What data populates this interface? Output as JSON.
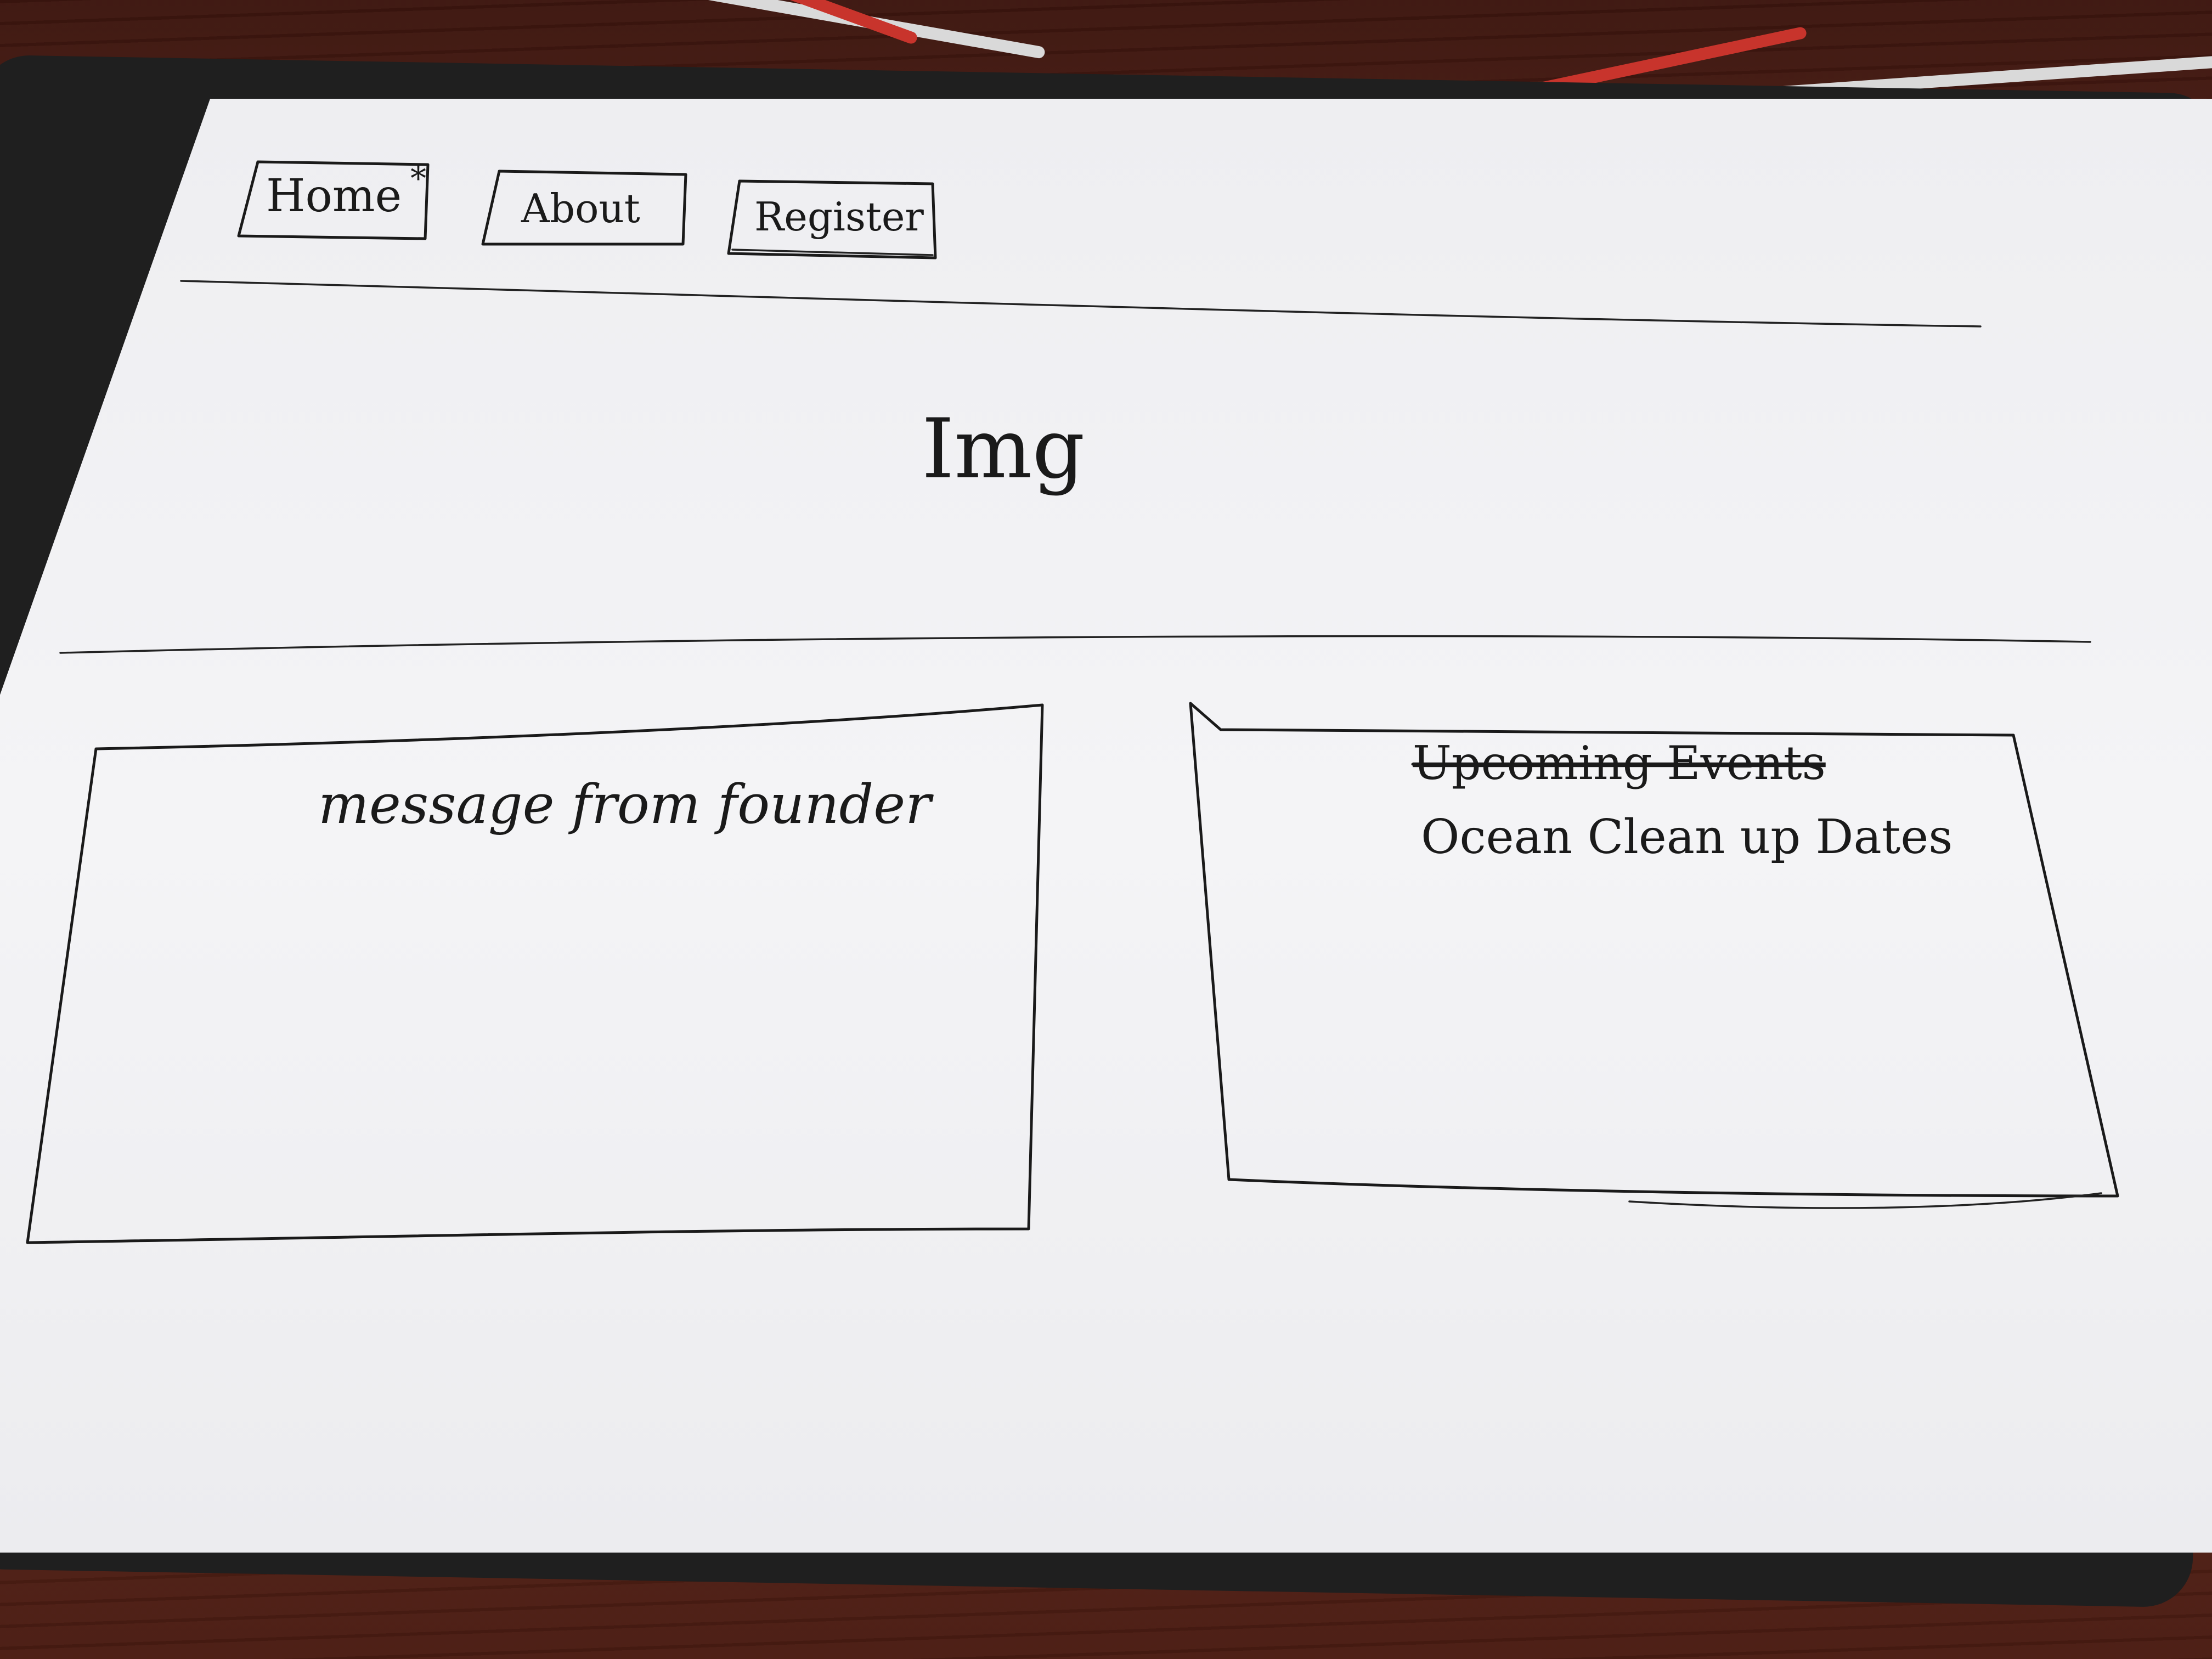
{
  "nav": {
    "items": [
      {
        "label": "Home",
        "active_mark": "*"
      },
      {
        "label": "About"
      },
      {
        "label": "Register"
      }
    ]
  },
  "hero": {
    "placeholder": "Img"
  },
  "panels": {
    "founder_message": {
      "title": "message from founder"
    },
    "events": {
      "crossed_out_title": "Upcoming Events",
      "item": "Ocean Clean up Dates"
    }
  }
}
